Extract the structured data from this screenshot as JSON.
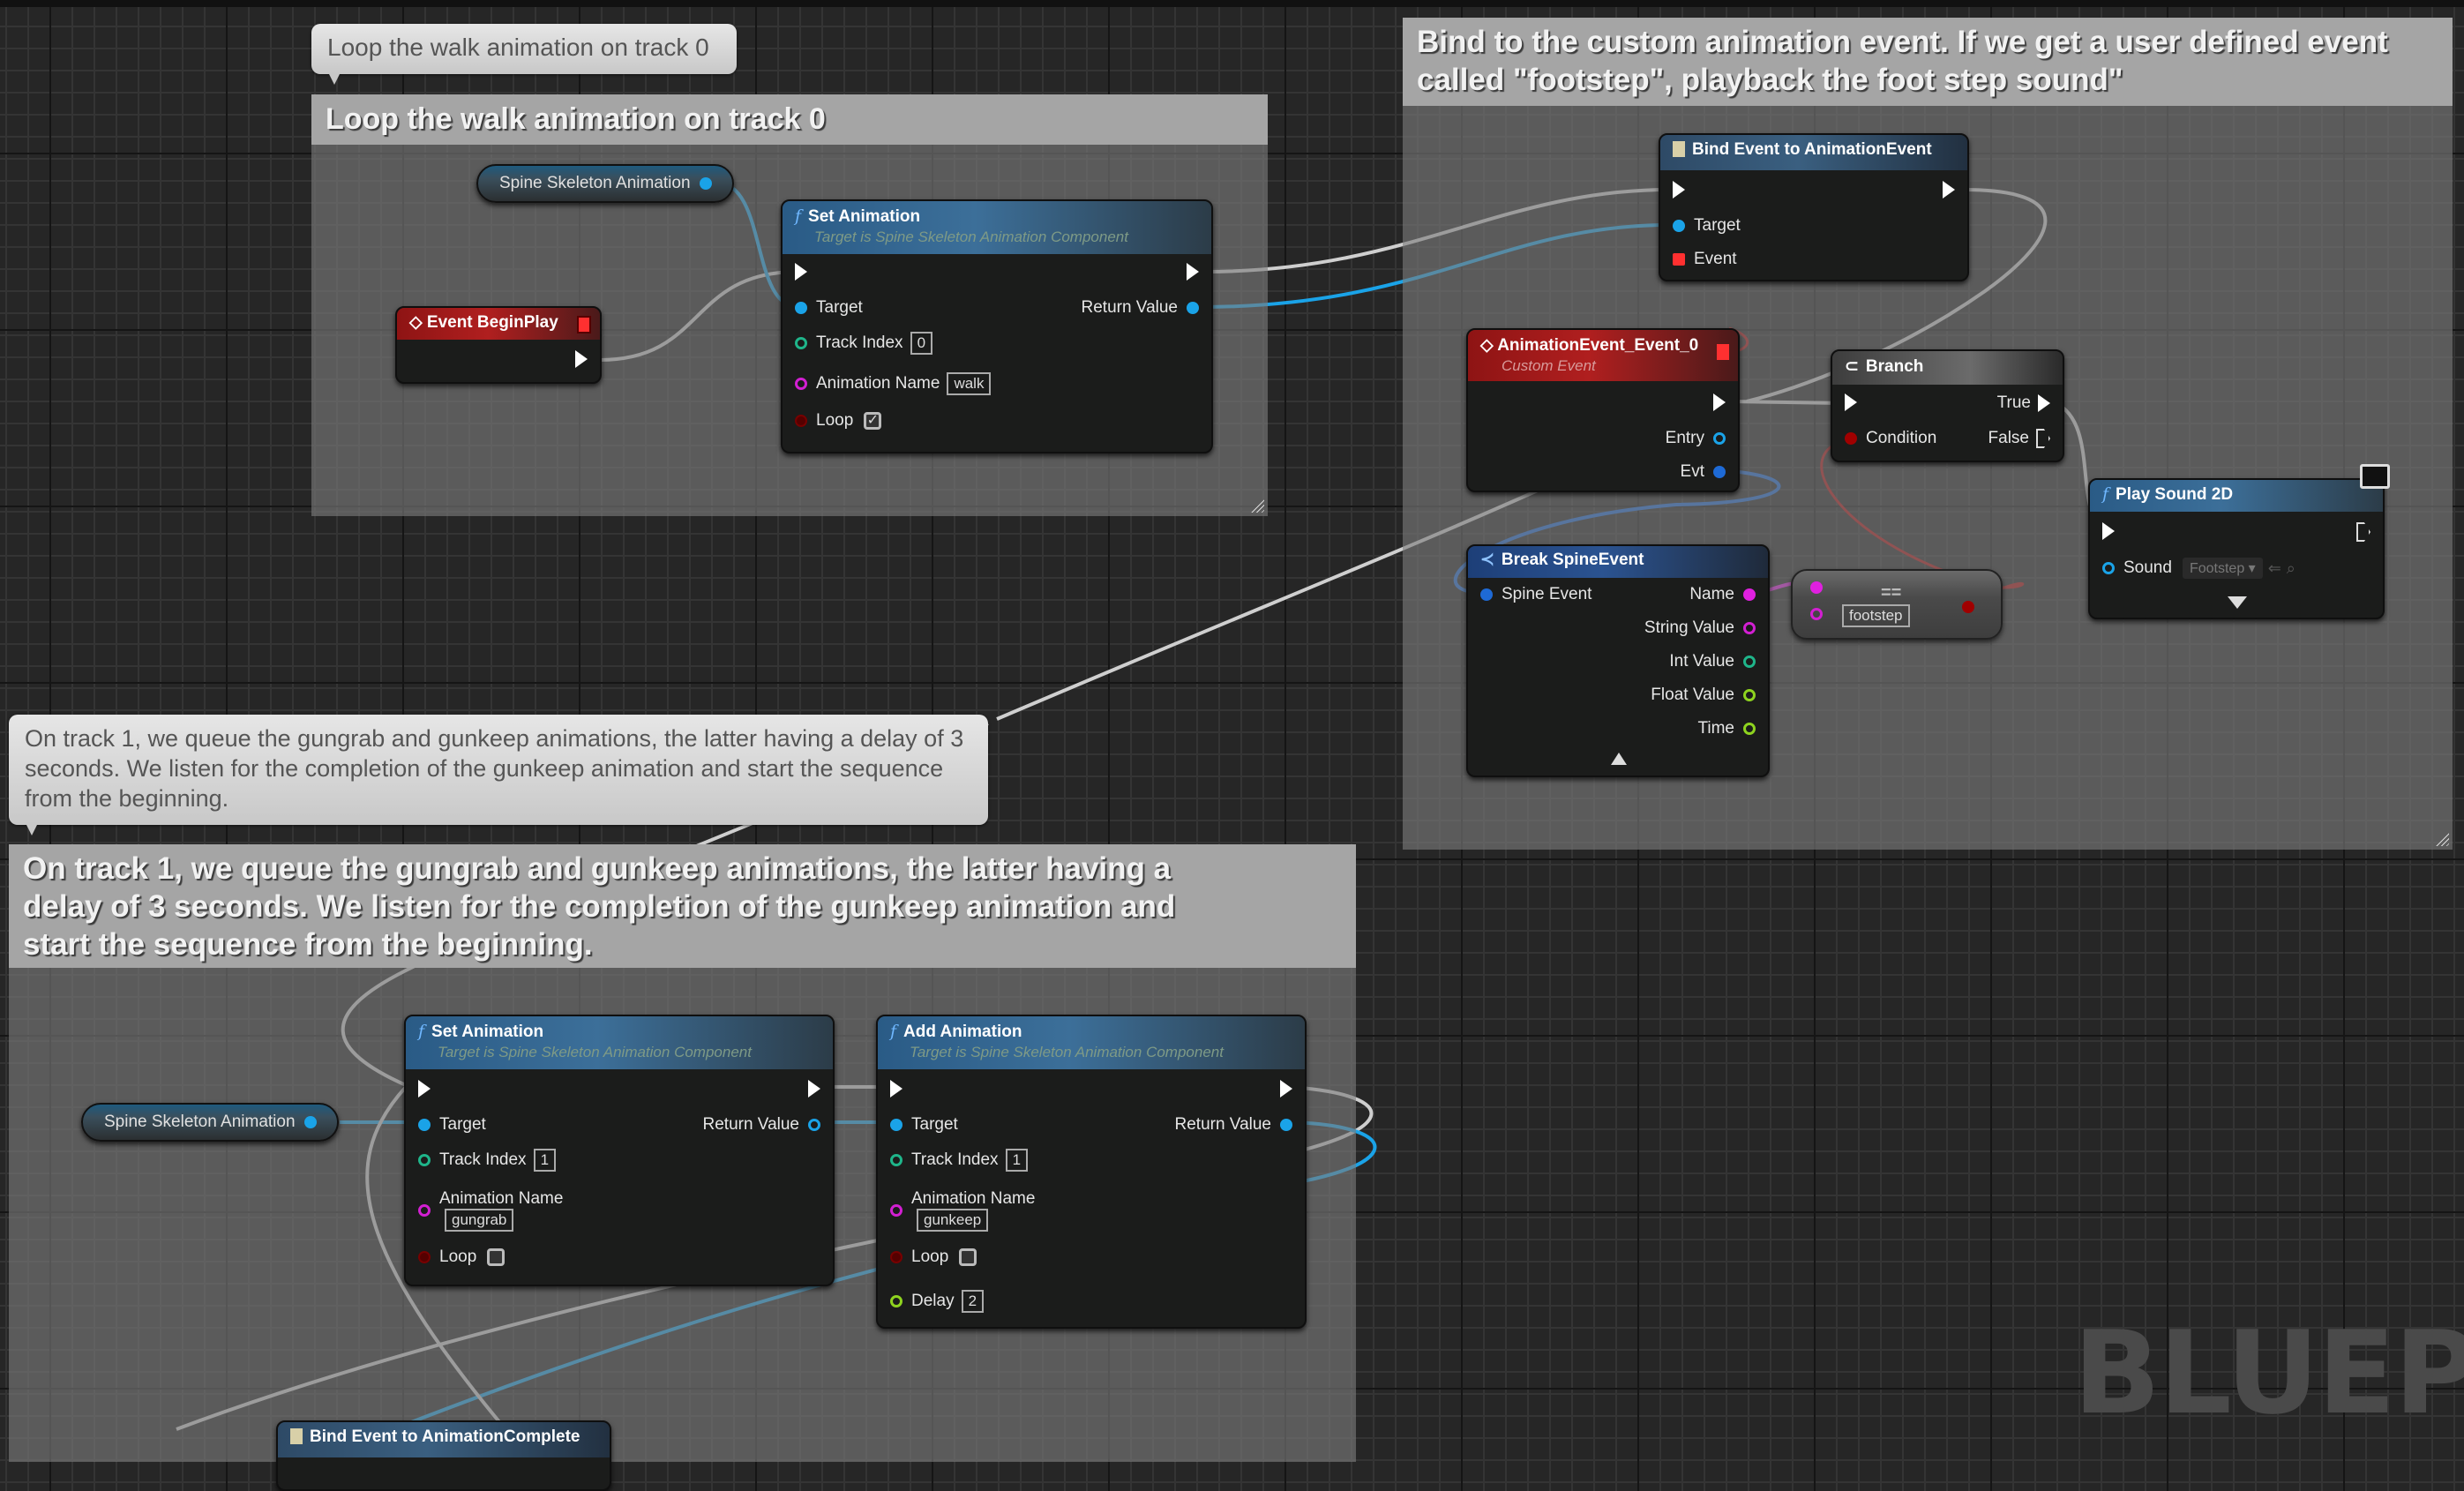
{
  "canvas": {
    "watermark": "BLUEPR",
    "colors": {
      "exec_wire": "#cfcfcf",
      "object_wire": "#1aa3e8",
      "struct_wire": "#1e6ad6",
      "bool_wire": "#b01010",
      "name_wire": "#e020e0",
      "function_header": "#3c6f99",
      "event_header": "#b01f1f"
    }
  },
  "comments": [
    {
      "bubble": "Loop the walk animation on track 0",
      "title": "Loop the walk animation on track 0"
    },
    {
      "title": "Bind to the custom animation event. If we get a user defined event called \"footstep\", playback the foot step sound\""
    },
    {
      "bubble": "On track 1, we queue the gungrab and gunkeep animations, the latter having a delay of 3 seconds. We listen for the completion of the gunkeep animation and start the sequence from the beginning.",
      "title": "On track 1, we queue the gungrab and gunkeep animations, the latter having a delay of 3 seconds. We listen for the completion of the gunkeep animation and start the sequence from the beginning."
    }
  ],
  "nodes": {
    "spine_var_1": {
      "label": "Spine Skeleton Animation"
    },
    "event_begin_play": {
      "title": "Event BeginPlay"
    },
    "set_animation_1": {
      "title": "Set Animation",
      "subtitle": "Target is Spine Skeleton Animation Component",
      "pins": {
        "target": "Target",
        "return": "Return Value",
        "track": "Track Index",
        "anim": "Animation Name",
        "loop": "Loop"
      },
      "values": {
        "track": "0",
        "anim": "walk",
        "loop": true,
        "loop_mark": "✓"
      }
    },
    "bind_anim_event": {
      "title": "Bind Event to AnimationEvent",
      "pins": {
        "target": "Target",
        "event": "Event"
      }
    },
    "custom_event": {
      "title": "AnimationEvent_Event_0",
      "subtitle": "Custom Event",
      "pins": {
        "entry": "Entry",
        "evt": "Evt"
      }
    },
    "branch": {
      "title": "Branch",
      "pins": {
        "condition": "Condition",
        "true": "True",
        "false": "False"
      }
    },
    "break_spine_event": {
      "title": "Break SpineEvent",
      "pins": {
        "in": "Spine Event",
        "name": "Name",
        "string": "String Value",
        "int": "Int Value",
        "float": "Float Value",
        "time": "Time"
      }
    },
    "equal_name": {
      "operator": "==",
      "value": "footstep"
    },
    "play_sound": {
      "title": "Play Sound 2D",
      "pins": {
        "sound": "Sound"
      },
      "values": {
        "sound": "Footstep ▾"
      }
    },
    "spine_var_2": {
      "label": "Spine Skeleton Animation"
    },
    "set_animation_2": {
      "title": "Set Animation",
      "subtitle": "Target is Spine Skeleton Animation Component",
      "pins": {
        "target": "Target",
        "return": "Return Value",
        "track": "Track Index",
        "anim": "Animation Name",
        "loop": "Loop"
      },
      "values": {
        "track": "1",
        "anim": "gungrab",
        "loop": false
      }
    },
    "add_animation": {
      "title": "Add Animation",
      "subtitle": "Target is Spine Skeleton Animation Component",
      "pins": {
        "target": "Target",
        "return": "Return Value",
        "track": "Track Index",
        "anim": "Animation Name",
        "loop": "Loop",
        "delay": "Delay"
      },
      "values": {
        "track": "1",
        "anim": "gunkeep",
        "loop": false,
        "delay": "2"
      }
    },
    "bind_anim_complete": {
      "title": "Bind Event to AnimationComplete"
    }
  }
}
